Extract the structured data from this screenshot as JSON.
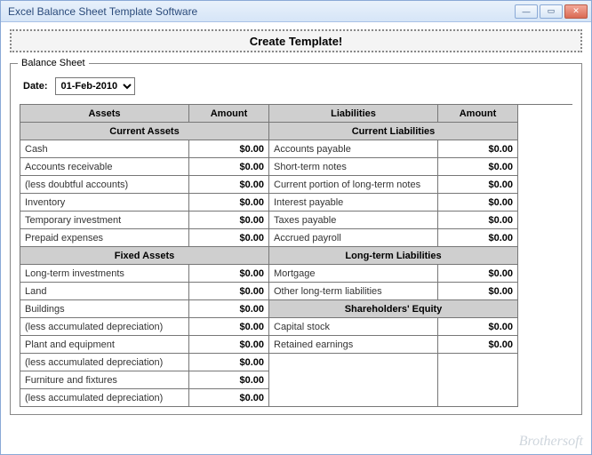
{
  "window": {
    "title": "Excel Balance Sheet Template Software"
  },
  "actions": {
    "create": "Create Template!"
  },
  "sheet": {
    "legend": "Balance Sheet",
    "date_label": "Date:",
    "date_value": "01-Feb-2010",
    "headers": {
      "assets": "Assets",
      "amount": "Amount",
      "liabilities": "Liabilities"
    },
    "sections": {
      "current_assets": "Current Assets",
      "current_liabilities": "Current Liabilities",
      "fixed_assets": "Fixed Assets",
      "long_term_liabilities": "Long-term Liabilities",
      "shareholders_equity": "Shareholders' Equity"
    },
    "assets": {
      "cash": {
        "label": "Cash",
        "amount": "$0.00"
      },
      "ar": {
        "label": "Accounts receivable",
        "amount": "$0.00"
      },
      "lda": {
        "label": "(less doubtful accounts)",
        "amount": "$0.00"
      },
      "inventory": {
        "label": "Inventory",
        "amount": "$0.00"
      },
      "temp_inv": {
        "label": "Temporary investment",
        "amount": "$0.00"
      },
      "prepaid": {
        "label": "Prepaid expenses",
        "amount": "$0.00"
      },
      "lt_inv": {
        "label": "Long-term investments",
        "amount": "$0.00"
      },
      "land": {
        "label": "Land",
        "amount": "$0.00"
      },
      "buildings": {
        "label": "Buildings",
        "amount": "$0.00"
      },
      "lad1": {
        "label": "(less accumulated depreciation)",
        "amount": "$0.00"
      },
      "plant": {
        "label": "Plant and equipment",
        "amount": "$0.00"
      },
      "lad2": {
        "label": "(less accumulated depreciation)",
        "amount": "$0.00"
      },
      "furniture": {
        "label": "Furniture and fixtures",
        "amount": "$0.00"
      },
      "lad3": {
        "label": "(less accumulated depreciation)",
        "amount": "$0.00"
      }
    },
    "liabilities": {
      "ap": {
        "label": "Accounts payable",
        "amount": "$0.00"
      },
      "stn": {
        "label": "Short-term notes",
        "amount": "$0.00"
      },
      "cpltn": {
        "label": "Current portion of long-term notes",
        "amount": "$0.00"
      },
      "ip": {
        "label": "Interest payable",
        "amount": "$0.00"
      },
      "tp": {
        "label": "Taxes payable",
        "amount": "$0.00"
      },
      "apr": {
        "label": "Accrued payroll",
        "amount": "$0.00"
      },
      "mortgage": {
        "label": "Mortgage",
        "amount": "$0.00"
      },
      "oltl": {
        "label": "Other long-term liabilities",
        "amount": "$0.00"
      },
      "capital": {
        "label": "Capital stock",
        "amount": "$0.00"
      },
      "retained": {
        "label": "Retained earnings",
        "amount": "$0.00"
      }
    }
  },
  "watermark": "Brothersoft"
}
